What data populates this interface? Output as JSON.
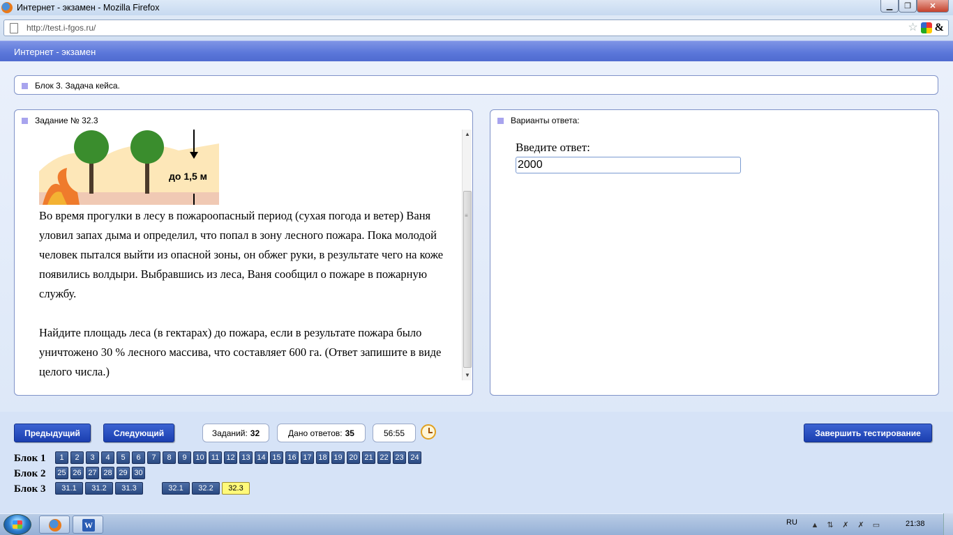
{
  "browser": {
    "window_title": "Интернет - экзамен - Mozilla Firefox",
    "url": "http://test.i-fgos.ru/",
    "controls": {
      "minimize": "▁",
      "maximize": "❐",
      "close": "✕"
    }
  },
  "app": {
    "title": "Интернет - экзамен",
    "block_heading": "Блок 3. Задача кейса.",
    "task_heading": "Задание № 32.3",
    "answers_heading": "Варианты ответа:",
    "illustration": {
      "caption": "до 1,5 м"
    },
    "task_paragraphs": [
      "Во время прогулки в лесу в пожароопасный период (сухая погода и ветер) Ваня уловил запах дыма и определил, что попал в зону лесного пожара. Пока молодой человек пытался выйти из опасной зоны, он обжег руки, в результате чего на коже появились волдыри. Выбравшись из леса, Ваня сообщил о пожаре в пожарную службу.",
      "Найдите площадь леса (в гектарах) до пожара, если в результате пожара было уничтожено 30 % лесного массива, что составляет 600 га. (Ответ запишите в виде целого числа.)"
    ],
    "answer_prompt": "Введите ответ:",
    "answer_value": "2000"
  },
  "footer": {
    "prev_label": "Предыдущий",
    "next_label": "Следующий",
    "finish_label": "Завершить тестирование",
    "tasks_label": "Заданий:",
    "tasks_value": "32",
    "answered_label": "Дано ответов:",
    "answered_value": "35",
    "timer": "56:55",
    "blocks": [
      {
        "label": "Блок 1",
        "items": [
          "1",
          "2",
          "3",
          "4",
          "5",
          "6",
          "7",
          "8",
          "9",
          "10",
          "11",
          "12",
          "13",
          "14",
          "15",
          "16",
          "17",
          "18",
          "19",
          "20",
          "21",
          "22",
          "23",
          "24"
        ]
      },
      {
        "label": "Блок 2",
        "items": [
          "25",
          "26",
          "27",
          "28",
          "29",
          "30"
        ]
      },
      {
        "label": "Блок 3",
        "items": [
          "31.1",
          "31.2",
          "31.3",
          "32.1",
          "32.2",
          "32.3"
        ]
      }
    ],
    "current_item": "32.3"
  },
  "taskbar": {
    "language": "RU",
    "clock": "21:38"
  }
}
